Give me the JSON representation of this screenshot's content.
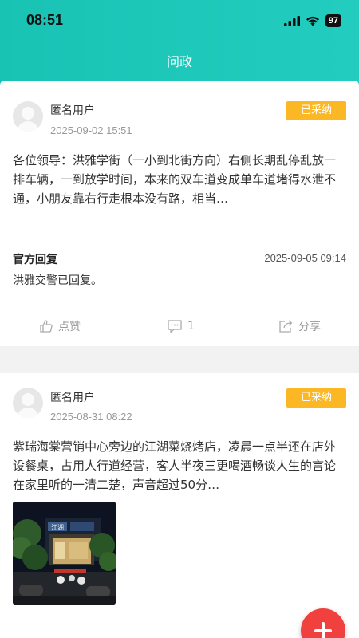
{
  "status_bar": {
    "time": "08:51",
    "battery": "97"
  },
  "header": {
    "title": "问政"
  },
  "posts": [
    {
      "user": "匿名用户",
      "date": "2025-09-02 15:51",
      "badge": "已采纳",
      "text": "各位领导：洪雅学街（一小到北街方向）右侧长期乱停乱放一排车辆，一到放学时间，本来的双车道变成单车道堵得水泄不通，小朋友靠右行走根本没有路，相当…",
      "reply": {
        "label": "官方回复",
        "date": "2025-09-05 09:14",
        "text": "洪雅交警已回复。"
      },
      "actions": {
        "like": "点赞",
        "comments": "1",
        "share": "分享"
      }
    },
    {
      "user": "匿名用户",
      "date": "2025-08-31 08:22",
      "badge": "已采纳",
      "text": "紫瑞海棠营销中心旁边的江湖菜烧烤店，凌晨一点半还在店外设餐桌，占用人行道经营，客人半夜三更喝酒畅谈人生的言论在家里听的一清二楚，声音超过50分…",
      "photo_sign": "江湖"
    }
  ],
  "icons": {
    "like": "thumbs-up-icon",
    "comment": "comment-icon",
    "share": "share-icon",
    "add": "plus-icon"
  },
  "colors": {
    "header": "#1fc8ba",
    "badge": "#fcb724",
    "fab": "#f0413e"
  }
}
